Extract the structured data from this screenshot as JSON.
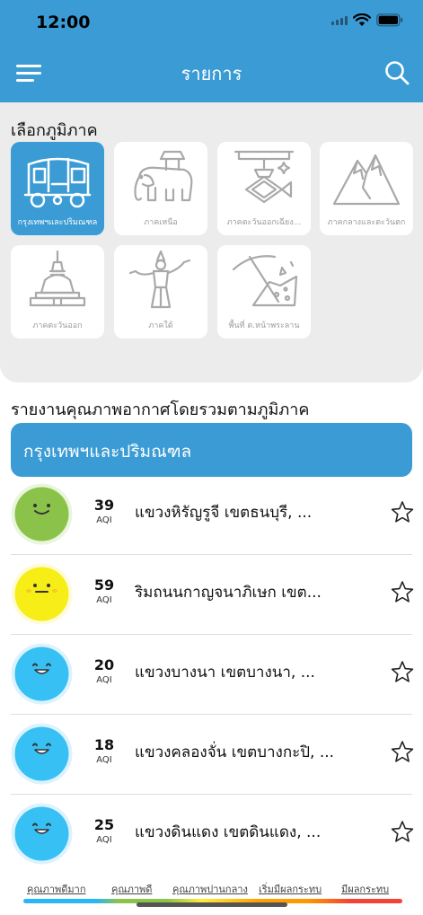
{
  "status_bar": {
    "time": "12:00"
  },
  "header": {
    "title": "รายการ",
    "menu_icon": "menu-icon",
    "search_icon": "search-icon"
  },
  "regions": {
    "heading": "เลือกภูมิภาค",
    "selected_index": 0,
    "items": [
      {
        "label": "กรุงเทพฯและปริมณฑล",
        "icon": "tuk-tuk-icon",
        "selected": true
      },
      {
        "label": "ภาคเหนือ",
        "icon": "elephant-icon",
        "selected": false
      },
      {
        "label": "ภาคตะวันออกเฉียง...",
        "icon": "fish-lantern-icon",
        "selected": false
      },
      {
        "label": "ภาคกลางและตะวันตก",
        "icon": "mountain-icon",
        "selected": false
      },
      {
        "label": "ภาคตะวันออก",
        "icon": "stupa-icon",
        "selected": false
      },
      {
        "label": "ภาคใต้",
        "icon": "dancer-icon",
        "selected": false
      },
      {
        "label": "พื้นที่ ต.หน้าพระลาน",
        "icon": "pickaxe-icon",
        "selected": false
      }
    ]
  },
  "report": {
    "heading": "รายงานคุณภาพอากาศโดยรวมตามภูมิภาค",
    "banner": "กรุงเทพฯและปริมณฑล",
    "aqi_label": "AQI",
    "stations": [
      {
        "aqi": "39",
        "name": "แขวงหิรัญรูจี เขตธนบุรี, ...",
        "face": "good-face-icon",
        "color": "#8bc34a"
      },
      {
        "aqi": "59",
        "name": "ริมถนนกาญจนาภิเษก เขต...",
        "face": "moderate-face-icon",
        "color": "#ffeb3b"
      },
      {
        "aqi": "20",
        "name": "แขวงบางนา เขตบางนา, ...",
        "face": "very-good-face-icon",
        "color": "#29b6f6"
      },
      {
        "aqi": "18",
        "name": "แขวงคลองจั่น เขตบางกะปิ, ...",
        "face": "very-good-face-icon",
        "color": "#29b6f6"
      },
      {
        "aqi": "25",
        "name": "แขวงดินแดง เขตดินแดง, ...",
        "face": "very-good-face-icon",
        "color": "#29b6f6"
      }
    ]
  },
  "legend": {
    "items": [
      {
        "label": "คุณภาพดีมาก",
        "color": "#29b6f6"
      },
      {
        "label": "คุณภาพดี",
        "color": "#8bc34a"
      },
      {
        "label": "คุณภาพปานกลาง",
        "color": "#ffeb3b"
      },
      {
        "label": "เริ่มมีผลกระทบ",
        "color": "#ff9800"
      },
      {
        "label": "มีผลกระทบ",
        "color": "#f44336"
      }
    ]
  },
  "colors": {
    "primary": "#3a9bd5",
    "panel": "#ececec"
  }
}
